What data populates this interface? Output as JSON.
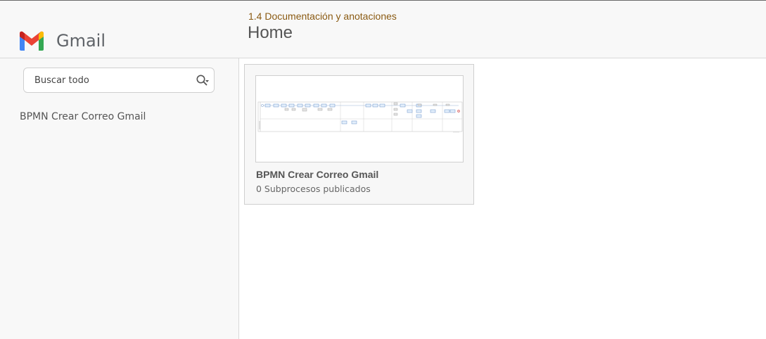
{
  "header": {
    "logo_text": "Gmail",
    "logo_icon": "gmail-m-icon",
    "breadcrumb": "1.4 Documentación y anotaciones",
    "title": "Home"
  },
  "sidebar": {
    "search": {
      "placeholder": "Buscar todo",
      "value": "",
      "icon": "search-filter-icon"
    },
    "items": [
      {
        "label": "BPMN Crear Correo Gmail"
      }
    ]
  },
  "main": {
    "cards": [
      {
        "title": "BPMN Crear Correo Gmail",
        "subtitle": "0 Subprocesos publicados",
        "thumbnail": "bpmn-diagram-thumbnail"
      }
    ]
  },
  "colors": {
    "breadcrumb": "#8a5a12",
    "header_bg": "#f8f8f8",
    "sidebar_bg": "#f8f8f8",
    "card_bg": "#f7f7f7",
    "text": "#555555",
    "gmail_red": "#ea4335",
    "gmail_blue": "#4285f4",
    "gmail_green": "#34a853",
    "gmail_yellow": "#fbbc04"
  }
}
